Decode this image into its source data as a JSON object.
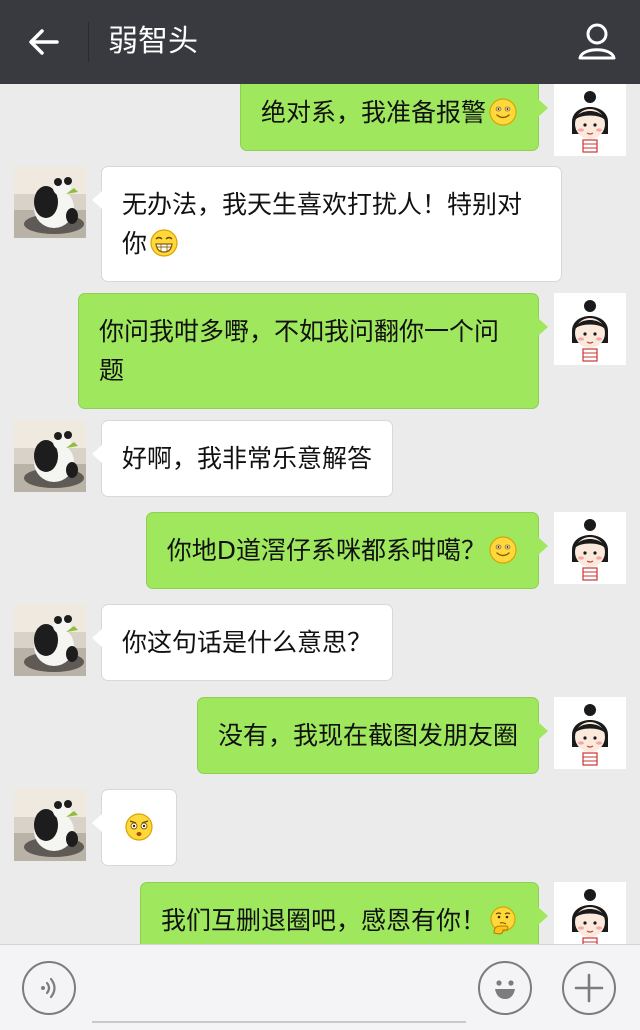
{
  "header": {
    "title": "弱智头",
    "back_icon": "back-arrow-icon",
    "profile_icon": "person-icon",
    "background": "#393a3f"
  },
  "colors": {
    "outgoing_bubble": "#9fe75d",
    "incoming_bubble": "#ffffff",
    "chat_background": "#ebebeb"
  },
  "messages": [
    {
      "sender": "me",
      "text": "绝对系，我准备报警",
      "emoji": "smile-emoji"
    },
    {
      "sender": "them",
      "text": "无办法，我天生喜欢打扰人！特别对你",
      "emoji": "grin-emoji"
    },
    {
      "sender": "me",
      "text": "你问我咁多嘢，不如我问翻你一个问题",
      "emoji": ""
    },
    {
      "sender": "them",
      "text": "好啊，我非常乐意解答",
      "emoji": ""
    },
    {
      "sender": "me",
      "text": "你地D道滘仔系咪都系咁噶？",
      "emoji": "smile-emoji"
    },
    {
      "sender": "them",
      "text": "你这句话是什么意思？",
      "emoji": ""
    },
    {
      "sender": "me",
      "text": "没有，我现在截图发朋友圈",
      "emoji": ""
    },
    {
      "sender": "them",
      "text": "",
      "emoji": "shocked-emoji"
    },
    {
      "sender": "me",
      "text": "我们互删退圈吧，感恩有你！",
      "emoji": "thinking-emoji"
    }
  ],
  "input_bar": {
    "voice_icon": "voice-icon",
    "emoji_icon": "emoji-face-icon",
    "plus_icon": "plus-icon",
    "input_value": ""
  }
}
